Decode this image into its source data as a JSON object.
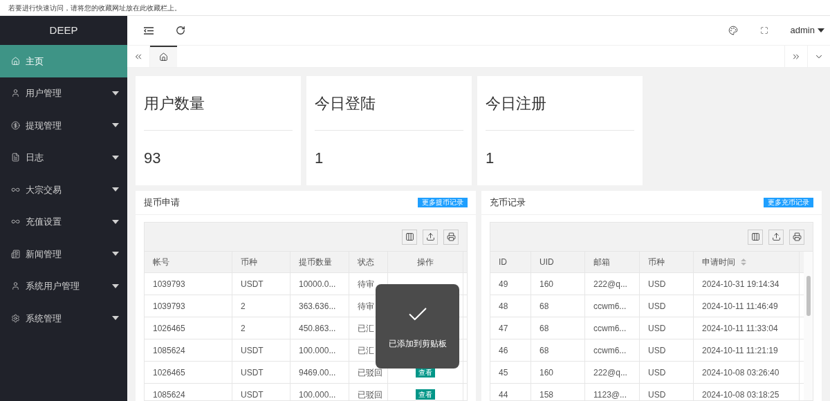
{
  "bookmark_bar": {
    "hint": "若要进行快速访问，请将您的收藏网址放在此收藏栏上。"
  },
  "sidebar": {
    "logo": "DEEP",
    "items": [
      {
        "label": "主页",
        "selected": true,
        "submenu": false
      },
      {
        "label": "用户管理",
        "selected": false,
        "submenu": true
      },
      {
        "label": "提现管理",
        "selected": false,
        "submenu": true
      },
      {
        "label": "日志",
        "selected": false,
        "submenu": true
      },
      {
        "label": "大宗交易",
        "selected": false,
        "submenu": true
      },
      {
        "label": "充值设置",
        "selected": false,
        "submenu": true
      },
      {
        "label": "新闻管理",
        "selected": false,
        "submenu": true
      },
      {
        "label": "系统用户管理",
        "selected": false,
        "submenu": true
      },
      {
        "label": "系统管理",
        "selected": false,
        "submenu": true
      }
    ]
  },
  "header": {
    "user": "admin"
  },
  "tabs": [
    {
      "selected": true
    }
  ],
  "stats": [
    {
      "title": "用户数量",
      "value": "93"
    },
    {
      "title": "今日登陆",
      "value": "1"
    },
    {
      "title": "今日注册",
      "value": "1"
    }
  ],
  "panels": [
    {
      "title": "提币申请",
      "more": "更多提币记录",
      "columns": [
        {
          "label": "帐号",
          "sortable": false
        },
        {
          "label": "币种",
          "sortable": false
        },
        {
          "label": "提币数量",
          "sortable": false
        },
        {
          "label": "状态",
          "sortable": false
        },
        {
          "label": "操作",
          "sortable": false
        }
      ],
      "rows": [
        {
          "cells": [
            "1039793",
            "USDT",
            "10000.0...",
            "待审"
          ]
        },
        {
          "cells": [
            "1039793",
            "2",
            "363.636...",
            "待审"
          ]
        },
        {
          "cells": [
            "1026465",
            "2",
            "450.863...",
            "已汇"
          ]
        },
        {
          "cells": [
            "1085624",
            "USDT",
            "100.000...",
            "已汇"
          ]
        },
        {
          "cells": [
            "1026465",
            "USDT",
            "9469.00...",
            "已驳回"
          ],
          "action": "查看"
        },
        {
          "cells": [
            "1085624",
            "USDT",
            "100.000...",
            "已驳回"
          ],
          "action": "查看"
        }
      ]
    },
    {
      "title": "充币记录",
      "more": "更多充币记录",
      "columns": [
        {
          "label": "ID",
          "sortable": false
        },
        {
          "label": "UID",
          "sortable": false
        },
        {
          "label": "邮箱",
          "sortable": false
        },
        {
          "label": "币种",
          "sortable": false
        },
        {
          "label": "申请时间",
          "sortable": true
        }
      ],
      "rows": [
        {
          "cells": [
            "49",
            "160",
            "222@q...",
            "USD",
            "2024-10-31 19:14:34"
          ]
        },
        {
          "cells": [
            "48",
            "68",
            "ccwm6...",
            "USD",
            "2024-10-11 11:46:49"
          ]
        },
        {
          "cells": [
            "47",
            "68",
            "ccwm6...",
            "USD",
            "2024-10-11 11:33:04"
          ]
        },
        {
          "cells": [
            "46",
            "68",
            "ccwm6...",
            "USD",
            "2024-10-11 11:21:19"
          ]
        },
        {
          "cells": [
            "45",
            "160",
            "222@q...",
            "USD",
            "2024-10-08 03:26:40"
          ]
        },
        {
          "cells": [
            "44",
            "158",
            "1123@...",
            "USD",
            "2024-10-08 03:18:25"
          ]
        }
      ]
    }
  ],
  "toast": {
    "message": "已添加到剪贴板"
  }
}
